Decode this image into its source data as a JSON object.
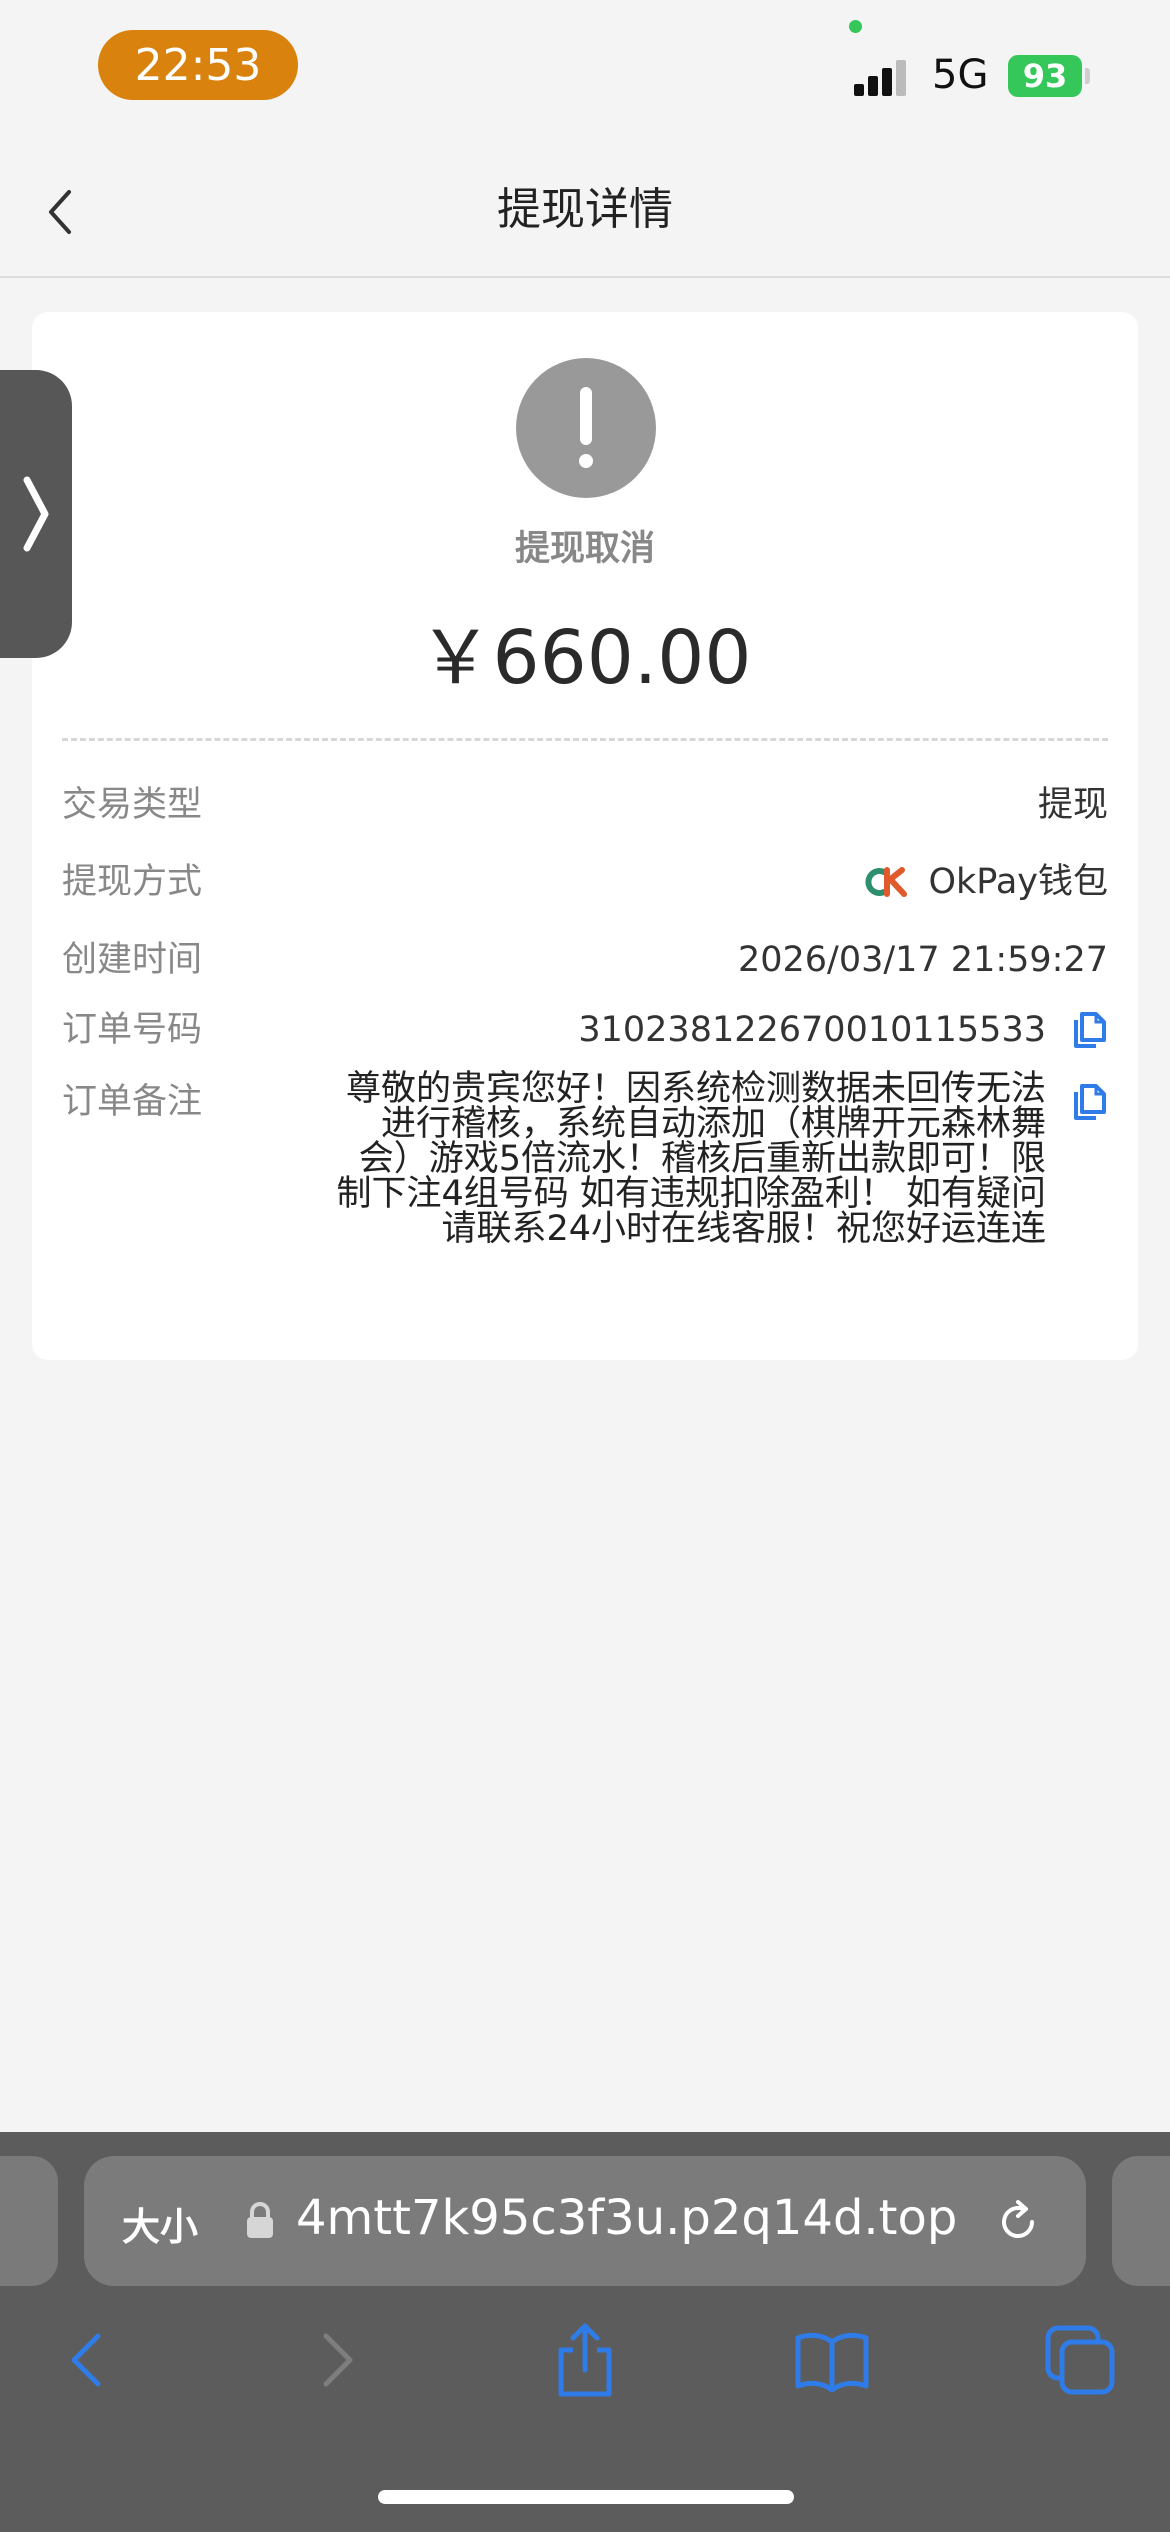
{
  "status_bar": {
    "time": "22:53",
    "network": "5G",
    "battery": "93"
  },
  "nav": {
    "title": "提现详情"
  },
  "detail": {
    "status": "提现取消",
    "amount": "￥660.00",
    "rows": [
      {
        "label": "交易类型",
        "value": "提现"
      },
      {
        "label": "提现方式",
        "value": "OkPay钱包"
      },
      {
        "label": "创建时间",
        "value": "2026/03/17 21:59:27"
      },
      {
        "label": "订单号码",
        "value": "310238122670010115533"
      },
      {
        "label": "订单备注",
        "value": "尊敬的贵宾您好！因系统检测数据未回传无法进行稽核，系统自动添加（棋牌开元森林舞会）游戏5倍流水！稽核后重新出款即可！限制下注4组号码 如有违规扣除盈利！ 如有疑问请联系24小时在线客服！祝您好运连连"
      }
    ]
  },
  "browser": {
    "text_size_label": "大小",
    "url": "4mtt7k95c3f3u.p2q14d.top"
  },
  "icons": {
    "back": "chevron-left-icon",
    "status": "exclamation-icon",
    "copy": "copy-icon",
    "lock": "lock-icon",
    "reload": "reload-icon",
    "share": "share-icon",
    "bookmarks": "book-icon",
    "tabs": "tabs-icon"
  },
  "colors": {
    "time_pill": "#d9820e",
    "battery": "#35c759",
    "link_blue": "#2f7ce8",
    "status_grey": "#999999"
  }
}
